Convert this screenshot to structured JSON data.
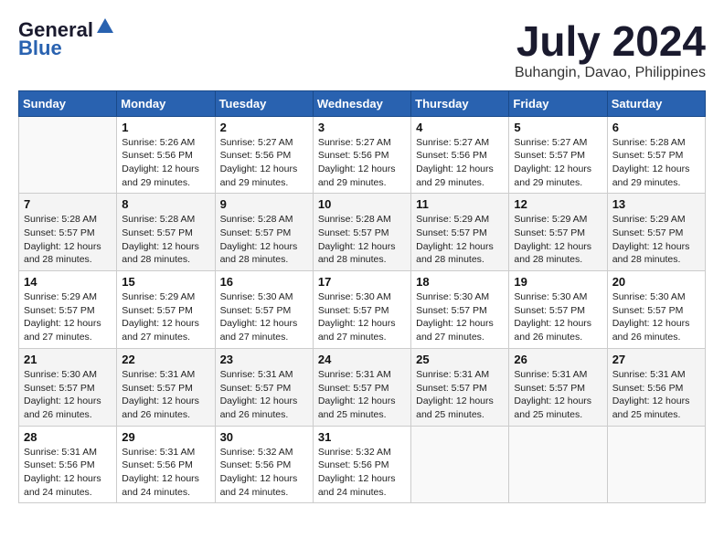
{
  "logo": {
    "general": "General",
    "blue": "Blue"
  },
  "title": "July 2024",
  "location": "Buhangin, Davao, Philippines",
  "days_of_week": [
    "Sunday",
    "Monday",
    "Tuesday",
    "Wednesday",
    "Thursday",
    "Friday",
    "Saturday"
  ],
  "weeks": [
    {
      "days": [
        {
          "number": "",
          "sunrise": "",
          "sunset": "",
          "daylight": "",
          "empty": true
        },
        {
          "number": "1",
          "sunrise": "Sunrise: 5:26 AM",
          "sunset": "Sunset: 5:56 PM",
          "daylight": "Daylight: 12 hours and 29 minutes.",
          "empty": false
        },
        {
          "number": "2",
          "sunrise": "Sunrise: 5:27 AM",
          "sunset": "Sunset: 5:56 PM",
          "daylight": "Daylight: 12 hours and 29 minutes.",
          "empty": false
        },
        {
          "number": "3",
          "sunrise": "Sunrise: 5:27 AM",
          "sunset": "Sunset: 5:56 PM",
          "daylight": "Daylight: 12 hours and 29 minutes.",
          "empty": false
        },
        {
          "number": "4",
          "sunrise": "Sunrise: 5:27 AM",
          "sunset": "Sunset: 5:56 PM",
          "daylight": "Daylight: 12 hours and 29 minutes.",
          "empty": false
        },
        {
          "number": "5",
          "sunrise": "Sunrise: 5:27 AM",
          "sunset": "Sunset: 5:57 PM",
          "daylight": "Daylight: 12 hours and 29 minutes.",
          "empty": false
        },
        {
          "number": "6",
          "sunrise": "Sunrise: 5:28 AM",
          "sunset": "Sunset: 5:57 PM",
          "daylight": "Daylight: 12 hours and 29 minutes.",
          "empty": false
        }
      ]
    },
    {
      "days": [
        {
          "number": "7",
          "sunrise": "Sunrise: 5:28 AM",
          "sunset": "Sunset: 5:57 PM",
          "daylight": "Daylight: 12 hours and 28 minutes.",
          "empty": false
        },
        {
          "number": "8",
          "sunrise": "Sunrise: 5:28 AM",
          "sunset": "Sunset: 5:57 PM",
          "daylight": "Daylight: 12 hours and 28 minutes.",
          "empty": false
        },
        {
          "number": "9",
          "sunrise": "Sunrise: 5:28 AM",
          "sunset": "Sunset: 5:57 PM",
          "daylight": "Daylight: 12 hours and 28 minutes.",
          "empty": false
        },
        {
          "number": "10",
          "sunrise": "Sunrise: 5:28 AM",
          "sunset": "Sunset: 5:57 PM",
          "daylight": "Daylight: 12 hours and 28 minutes.",
          "empty": false
        },
        {
          "number": "11",
          "sunrise": "Sunrise: 5:29 AM",
          "sunset": "Sunset: 5:57 PM",
          "daylight": "Daylight: 12 hours and 28 minutes.",
          "empty": false
        },
        {
          "number": "12",
          "sunrise": "Sunrise: 5:29 AM",
          "sunset": "Sunset: 5:57 PM",
          "daylight": "Daylight: 12 hours and 28 minutes.",
          "empty": false
        },
        {
          "number": "13",
          "sunrise": "Sunrise: 5:29 AM",
          "sunset": "Sunset: 5:57 PM",
          "daylight": "Daylight: 12 hours and 28 minutes.",
          "empty": false
        }
      ]
    },
    {
      "days": [
        {
          "number": "14",
          "sunrise": "Sunrise: 5:29 AM",
          "sunset": "Sunset: 5:57 PM",
          "daylight": "Daylight: 12 hours and 27 minutes.",
          "empty": false
        },
        {
          "number": "15",
          "sunrise": "Sunrise: 5:29 AM",
          "sunset": "Sunset: 5:57 PM",
          "daylight": "Daylight: 12 hours and 27 minutes.",
          "empty": false
        },
        {
          "number": "16",
          "sunrise": "Sunrise: 5:30 AM",
          "sunset": "Sunset: 5:57 PM",
          "daylight": "Daylight: 12 hours and 27 minutes.",
          "empty": false
        },
        {
          "number": "17",
          "sunrise": "Sunrise: 5:30 AM",
          "sunset": "Sunset: 5:57 PM",
          "daylight": "Daylight: 12 hours and 27 minutes.",
          "empty": false
        },
        {
          "number": "18",
          "sunrise": "Sunrise: 5:30 AM",
          "sunset": "Sunset: 5:57 PM",
          "daylight": "Daylight: 12 hours and 27 minutes.",
          "empty": false
        },
        {
          "number": "19",
          "sunrise": "Sunrise: 5:30 AM",
          "sunset": "Sunset: 5:57 PM",
          "daylight": "Daylight: 12 hours and 26 minutes.",
          "empty": false
        },
        {
          "number": "20",
          "sunrise": "Sunrise: 5:30 AM",
          "sunset": "Sunset: 5:57 PM",
          "daylight": "Daylight: 12 hours and 26 minutes.",
          "empty": false
        }
      ]
    },
    {
      "days": [
        {
          "number": "21",
          "sunrise": "Sunrise: 5:30 AM",
          "sunset": "Sunset: 5:57 PM",
          "daylight": "Daylight: 12 hours and 26 minutes.",
          "empty": false
        },
        {
          "number": "22",
          "sunrise": "Sunrise: 5:31 AM",
          "sunset": "Sunset: 5:57 PM",
          "daylight": "Daylight: 12 hours and 26 minutes.",
          "empty": false
        },
        {
          "number": "23",
          "sunrise": "Sunrise: 5:31 AM",
          "sunset": "Sunset: 5:57 PM",
          "daylight": "Daylight: 12 hours and 26 minutes.",
          "empty": false
        },
        {
          "number": "24",
          "sunrise": "Sunrise: 5:31 AM",
          "sunset": "Sunset: 5:57 PM",
          "daylight": "Daylight: 12 hours and 25 minutes.",
          "empty": false
        },
        {
          "number": "25",
          "sunrise": "Sunrise: 5:31 AM",
          "sunset": "Sunset: 5:57 PM",
          "daylight": "Daylight: 12 hours and 25 minutes.",
          "empty": false
        },
        {
          "number": "26",
          "sunrise": "Sunrise: 5:31 AM",
          "sunset": "Sunset: 5:57 PM",
          "daylight": "Daylight: 12 hours and 25 minutes.",
          "empty": false
        },
        {
          "number": "27",
          "sunrise": "Sunrise: 5:31 AM",
          "sunset": "Sunset: 5:56 PM",
          "daylight": "Daylight: 12 hours and 25 minutes.",
          "empty": false
        }
      ]
    },
    {
      "days": [
        {
          "number": "28",
          "sunrise": "Sunrise: 5:31 AM",
          "sunset": "Sunset: 5:56 PM",
          "daylight": "Daylight: 12 hours and 24 minutes.",
          "empty": false
        },
        {
          "number": "29",
          "sunrise": "Sunrise: 5:31 AM",
          "sunset": "Sunset: 5:56 PM",
          "daylight": "Daylight: 12 hours and 24 minutes.",
          "empty": false
        },
        {
          "number": "30",
          "sunrise": "Sunrise: 5:32 AM",
          "sunset": "Sunset: 5:56 PM",
          "daylight": "Daylight: 12 hours and 24 minutes.",
          "empty": false
        },
        {
          "number": "31",
          "sunrise": "Sunrise: 5:32 AM",
          "sunset": "Sunset: 5:56 PM",
          "daylight": "Daylight: 12 hours and 24 minutes.",
          "empty": false
        },
        {
          "number": "",
          "sunrise": "",
          "sunset": "",
          "daylight": "",
          "empty": true
        },
        {
          "number": "",
          "sunrise": "",
          "sunset": "",
          "daylight": "",
          "empty": true
        },
        {
          "number": "",
          "sunrise": "",
          "sunset": "",
          "daylight": "",
          "empty": true
        }
      ]
    }
  ]
}
